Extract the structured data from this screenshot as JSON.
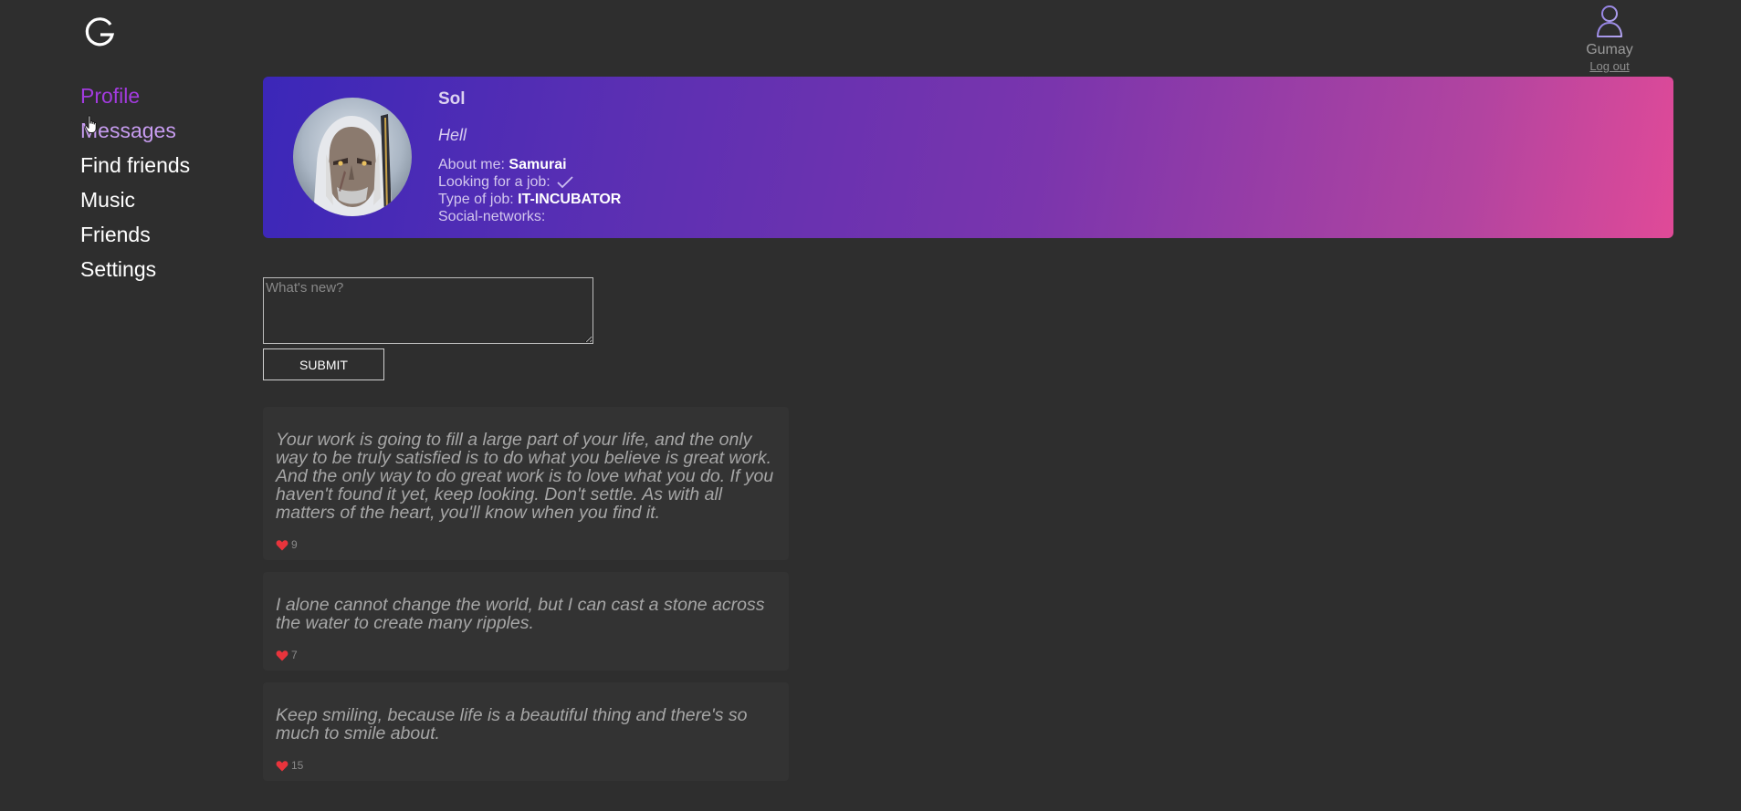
{
  "app": {
    "logo_letter": "G"
  },
  "user": {
    "name": "Gumay",
    "logout_label": "Log out"
  },
  "sidebar": {
    "items": [
      {
        "label": "Profile",
        "state": "active"
      },
      {
        "label": "Messages",
        "state": "hover"
      },
      {
        "label": "Find friends",
        "state": "normal"
      },
      {
        "label": "Music",
        "state": "normal"
      },
      {
        "label": "Friends",
        "state": "normal"
      },
      {
        "label": "Settings",
        "state": "normal"
      }
    ]
  },
  "profile": {
    "name": "Sol",
    "status": "Hell",
    "about_label": "About me:",
    "about_value": "Samurai",
    "looking_label": "Looking for a job:",
    "looking_value": true,
    "job_type_label": "Type of job:",
    "job_type_value": "IT-INCUBATOR",
    "social_label": "Social-networks:"
  },
  "new_post": {
    "placeholder": "What's new?",
    "value": "",
    "submit_label": "SUBMIT"
  },
  "posts": [
    {
      "text": "Your work is going to fill a large part of your life, and the only way to be truly satisfied is to do what you believe is great work. And the only way to do great work is to love what you do. If you haven't found it yet, keep looking. Don't settle. As with all matters of the heart, you'll know when you find it.",
      "likes": "9"
    },
    {
      "text": "I alone cannot change the world, but I can cast a stone across the water to create many ripples.",
      "likes": "7"
    },
    {
      "text": "Keep smiling, because life is a beautiful thing and there's so much to smile about.",
      "likes": "15"
    }
  ],
  "colors": {
    "background": "#2e2e2e",
    "nav_active": "#a23bde",
    "nav_hover": "#c79cf0",
    "heart": "#e8343c",
    "banner_start": "#3b27b8",
    "banner_end": "#e04a98"
  },
  "icons": {
    "logo": "g-logo-icon",
    "user": "user-outline-icon",
    "like": "heart-icon",
    "check": "checkmark-icon",
    "cursor": "hand-pointer-icon"
  }
}
